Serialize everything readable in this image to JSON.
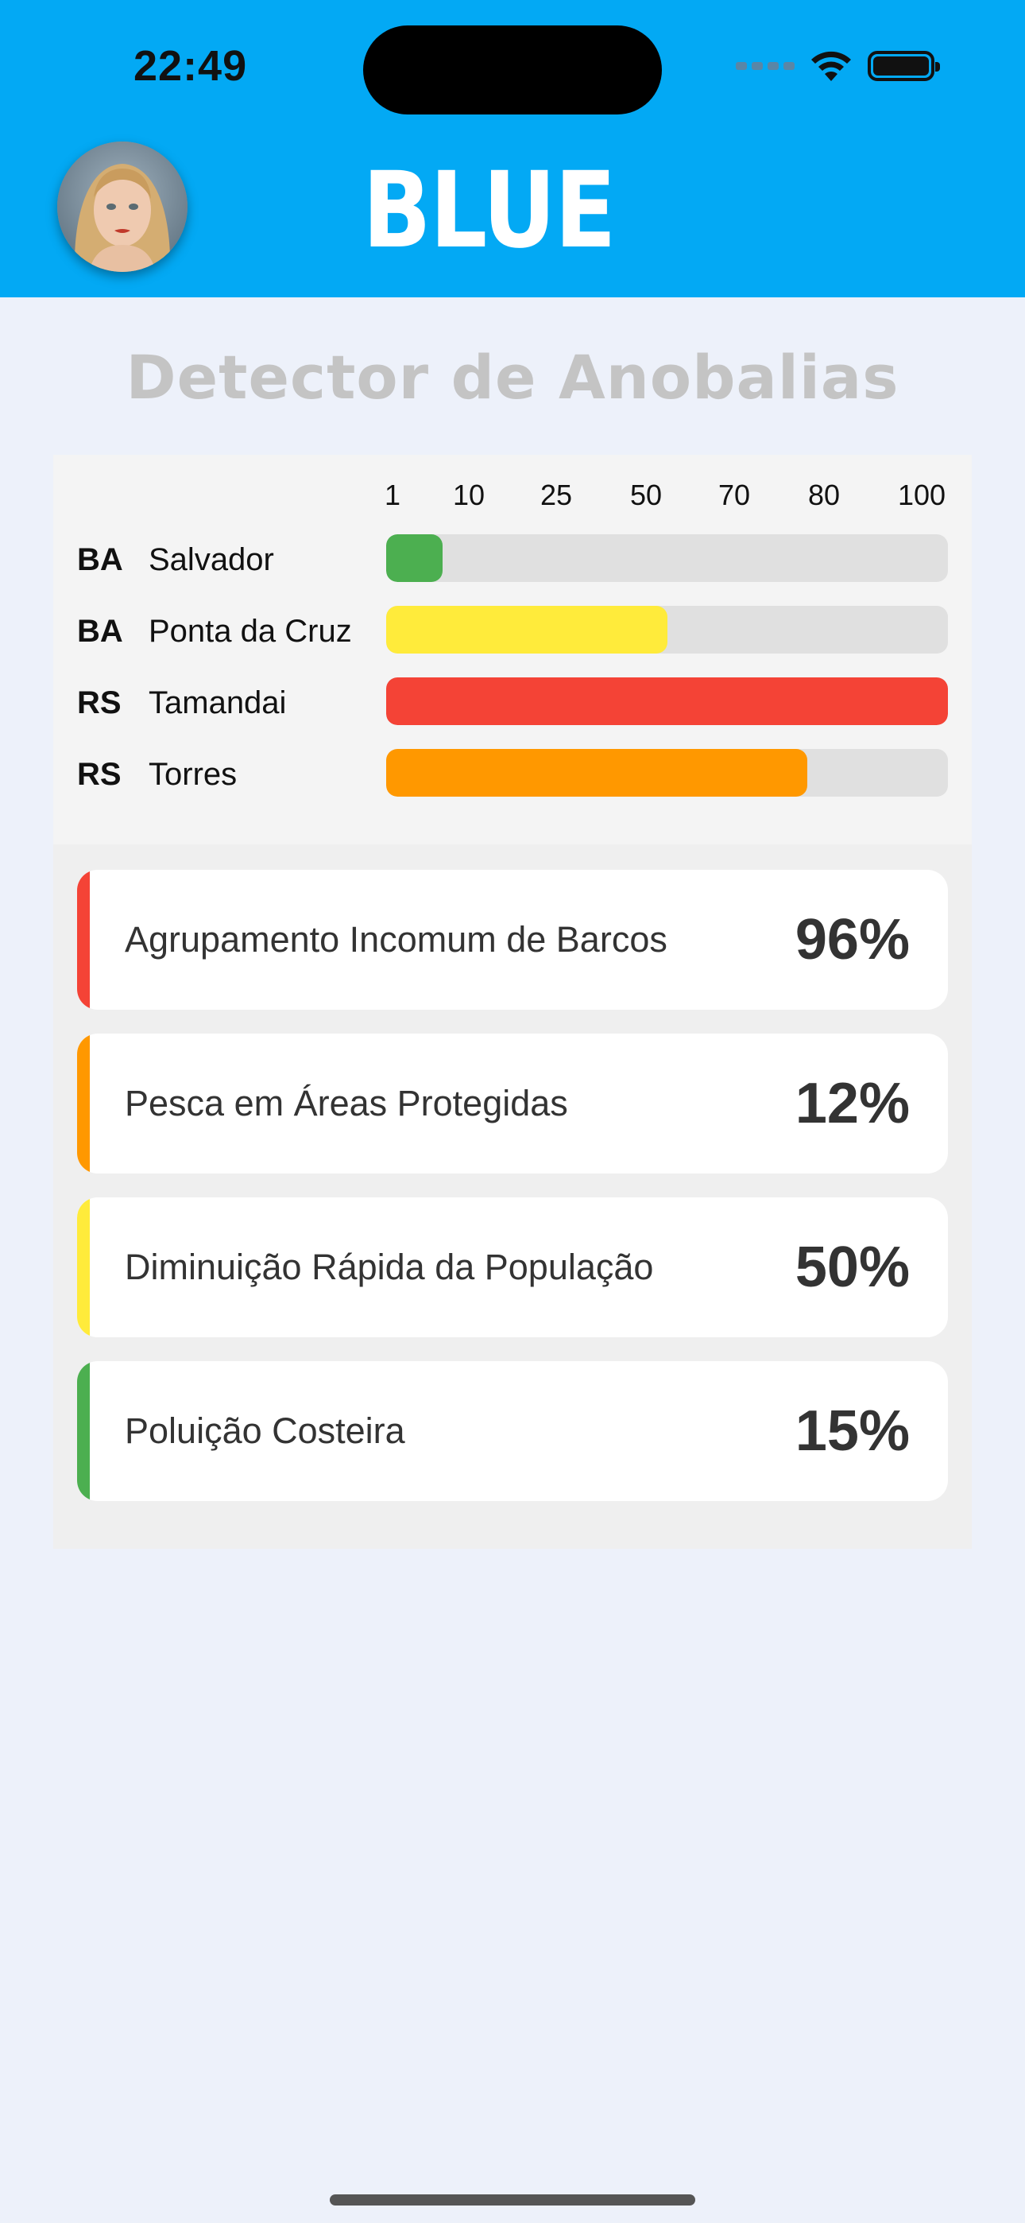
{
  "status_bar": {
    "time": "22:49"
  },
  "header": {
    "title": "BLUE",
    "background_color": "#03a9f4",
    "avatar_icon": "user-avatar"
  },
  "page": {
    "title": "Detector de Anobalias"
  },
  "bars": {
    "scale": [
      "1",
      "10",
      "25",
      "50",
      "70",
      "80",
      "100"
    ],
    "rows": [
      {
        "state": "BA",
        "city": "Salvador",
        "level": 10,
        "color": "#4caf50"
      },
      {
        "state": "BA",
        "city": "Ponta da Cruz",
        "level": 50,
        "color": "#ffeb3b"
      },
      {
        "state": "RS",
        "city": "Tamandai",
        "level": 100,
        "color": "#f44336"
      },
      {
        "state": "RS",
        "city": "Torres",
        "level": 75,
        "color": "#ff9800"
      }
    ]
  },
  "anomalies": [
    {
      "label": "Agrupamento Incomum de Barcos",
      "value": "96%",
      "color": "#f44336"
    },
    {
      "label": "Pesca em Áreas Protegidas",
      "value": "12%",
      "color": "#ff9800"
    },
    {
      "label": "Diminuição Rápida da População",
      "value": "50%",
      "color": "#ffeb3b"
    },
    {
      "label": "Poluição Costeira",
      "value": "15%",
      "color": "#4caf50"
    }
  ]
}
